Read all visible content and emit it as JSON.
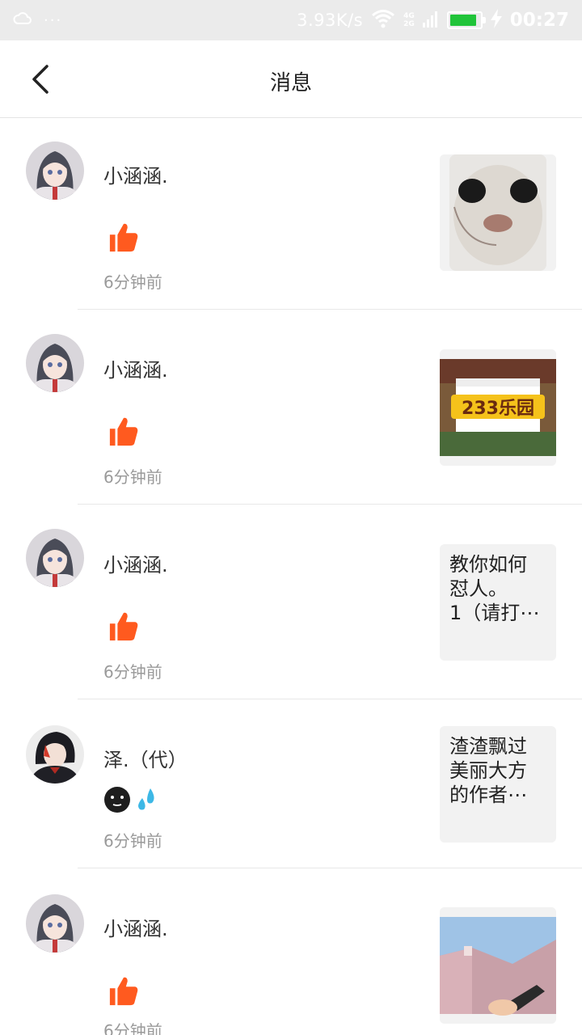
{
  "status_bar": {
    "speed": "3.93K/s",
    "network_top": "4G",
    "network_bottom": "2G",
    "time": "00:27",
    "battery_level": 0.9
  },
  "header": {
    "title": "消息",
    "back_icon": "chevron-left-icon"
  },
  "messages": [
    {
      "user": "小涵涵.",
      "type": "like",
      "time": "6分钟前",
      "thumb_type": "image",
      "thumb_desc": "cat-face-photo"
    },
    {
      "user": "小涵涵.",
      "type": "like",
      "time": "6分钟前",
      "thumb_type": "image",
      "thumb_desc": "game-screenshot",
      "thumb_caption": "233乐园"
    },
    {
      "user": "小涵涵.",
      "type": "like",
      "time": "6分钟前",
      "thumb_type": "text",
      "thumb_text": "教你如何\n怼人。\n1（请打⋯"
    },
    {
      "user": "泽.（代）",
      "type": "emoji",
      "time": "6分钟前",
      "thumb_type": "text",
      "thumb_text": "渣渣飘过\n美丽大方\n的作者⋯"
    },
    {
      "user": "小涵涵.",
      "type": "like",
      "time": "6分钟前",
      "thumb_type": "image",
      "thumb_desc": "game-screenshot-pink"
    }
  ],
  "colors": {
    "like": "#ff5a1f",
    "status_bg": "#ebebeb",
    "divider": "#e8e8e8",
    "time_text": "#9a9a9a"
  }
}
